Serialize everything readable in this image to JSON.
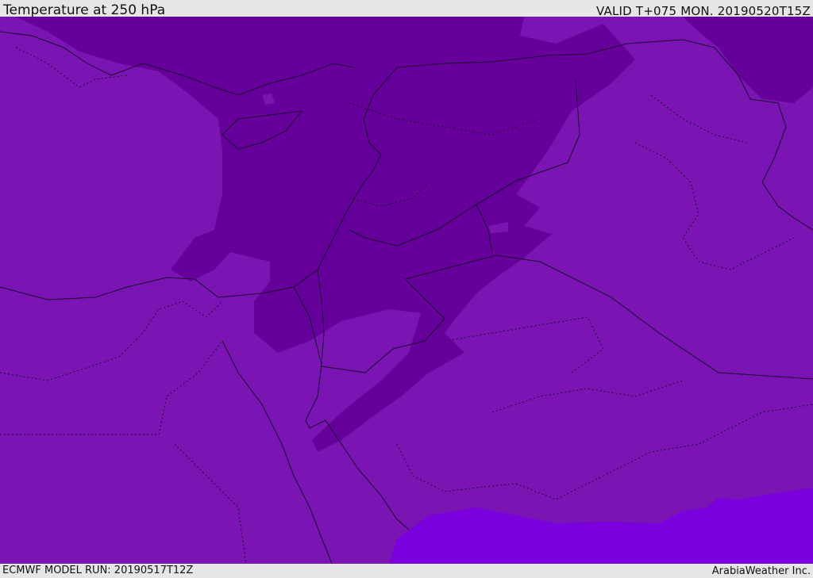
{
  "header": {
    "title": "Temperature at 250 hPa",
    "valid_time": "VALID T+075 MON. 20190520T15Z"
  },
  "footer": {
    "model_run": "ECMWF MODEL RUN: 20190517T12Z",
    "credit": "ArabiaWeather Inc."
  },
  "map": {
    "colors": {
      "base": "#7a15b3",
      "cold_band": "#66009a",
      "warm_patch": "#7a00dd",
      "land": "#7a15b3",
      "boundaries": "#1a0830"
    }
  }
}
